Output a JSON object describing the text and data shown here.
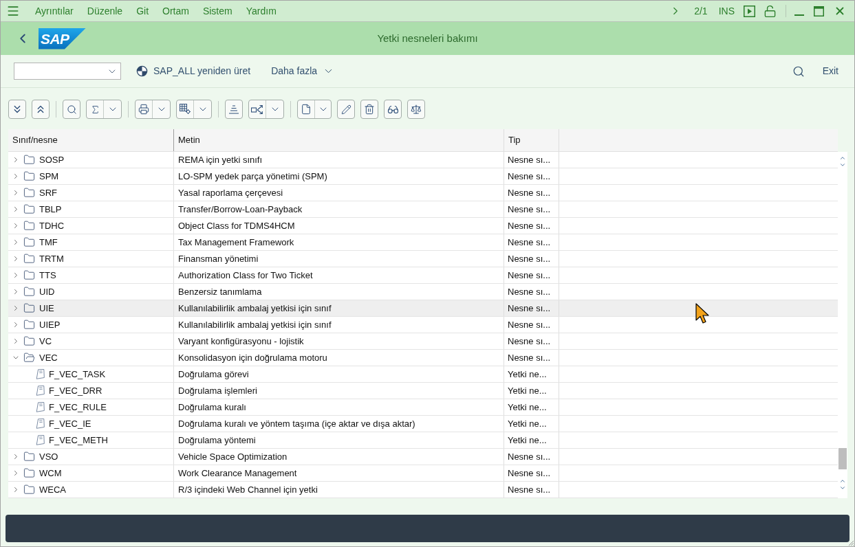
{
  "menu_bar": {
    "items": [
      "Ayrıntılar",
      "Düzenle",
      "Git",
      "Ortam",
      "Sistem",
      "Yardım"
    ],
    "page_indicator": "2/1",
    "input_mode": "INS"
  },
  "title_bar": {
    "logo": "SAP",
    "title": "Yetki nesneleri bakımı"
  },
  "toolbar": {
    "actions": [
      {
        "label": "SAP_ALL yeniden üret",
        "kind": "action"
      },
      {
        "label": "Daha fazla",
        "kind": "menu"
      }
    ],
    "exit": "Exit"
  },
  "table": {
    "columns": [
      "Sınıf/nesne",
      "Metin",
      "Tip"
    ],
    "rows": [
      {
        "name": "SOSP",
        "text": "REMA için yetki sınıfı",
        "type": "Nesne sı...",
        "kind": "class",
        "expanded": false,
        "selected": false
      },
      {
        "name": "SPM",
        "text": "LO-SPM yedek parça yönetimi (SPM)",
        "type": "Nesne sı...",
        "kind": "class",
        "expanded": false,
        "selected": false
      },
      {
        "name": "SRF",
        "text": "Yasal raporlama çerçevesi",
        "type": "Nesne sı...",
        "kind": "class",
        "expanded": false,
        "selected": false
      },
      {
        "name": "TBLP",
        "text": "Transfer/Borrow-Loan-Payback",
        "type": "Nesne sı...",
        "kind": "class",
        "expanded": false,
        "selected": false
      },
      {
        "name": "TDHC",
        "text": "Object Class for TDMS4HCM",
        "type": "Nesne sı...",
        "kind": "class",
        "expanded": false,
        "selected": false
      },
      {
        "name": "TMF",
        "text": "Tax Management Framework",
        "type": "Nesne sı...",
        "kind": "class",
        "expanded": false,
        "selected": false
      },
      {
        "name": "TRTM",
        "text": "Finansman yönetimi",
        "type": "Nesne sı...",
        "kind": "class",
        "expanded": false,
        "selected": false
      },
      {
        "name": "TTS",
        "text": "Authorization Class for Two Ticket",
        "type": "Nesne sı...",
        "kind": "class",
        "expanded": false,
        "selected": false
      },
      {
        "name": "UID",
        "text": "Benzersiz tanımlama",
        "type": "Nesne sı...",
        "kind": "class",
        "expanded": false,
        "selected": false
      },
      {
        "name": "UIE",
        "text": "Kullanılabilirlik ambalaj yetkisi için sınıf",
        "type": "Nesne sı...",
        "kind": "class",
        "expanded": false,
        "selected": true
      },
      {
        "name": "UIEP",
        "text": "Kullanılabilirlik ambalaj yetkisi için sınıf",
        "type": "Nesne sı...",
        "kind": "class",
        "expanded": false,
        "selected": false
      },
      {
        "name": "VC",
        "text": "Varyant konfigürasyonu - lojistik",
        "type": "Nesne sı...",
        "kind": "class",
        "expanded": false,
        "selected": false
      },
      {
        "name": "VEC",
        "text": "Konsolidasyon için doğrulama motoru",
        "type": "Nesne sı...",
        "kind": "class",
        "expanded": true,
        "selected": false,
        "children": [
          {
            "name": "F_VEC_TASK",
            "text": "Doğrulama görevi",
            "type": "Yetki ne...",
            "kind": "object",
            "selected": false
          },
          {
            "name": "F_VEC_DRR",
            "text": "Doğrulama işlemleri",
            "type": "Yetki ne...",
            "kind": "object",
            "selected": false
          },
          {
            "name": "F_VEC_RULE",
            "text": "Doğrulama kuralı",
            "type": "Yetki ne...",
            "kind": "object",
            "selected": false
          },
          {
            "name": "F_VEC_IE",
            "text": "Doğrulama kuralı ve yöntem taşıma (içe aktar ve dışa aktar)",
            "type": "Yetki ne...",
            "kind": "object",
            "selected": false
          },
          {
            "name": "F_VEC_METH",
            "text": "Doğrulama yöntemi",
            "type": "Yetki ne...",
            "kind": "object",
            "selected": false
          }
        ]
      },
      {
        "name": "VSO",
        "text": "Vehicle Space Optimization",
        "type": "Nesne sı...",
        "kind": "class",
        "expanded": false,
        "selected": false
      },
      {
        "name": "WCM",
        "text": "Work Clearance Management",
        "type": "Nesne sı...",
        "kind": "class",
        "expanded": false,
        "selected": false
      },
      {
        "name": "WECA",
        "text": "R/3 içindeki Web Channel için yetki",
        "type": "Nesne sı...",
        "kind": "class",
        "expanded": false,
        "selected": false
      }
    ]
  }
}
